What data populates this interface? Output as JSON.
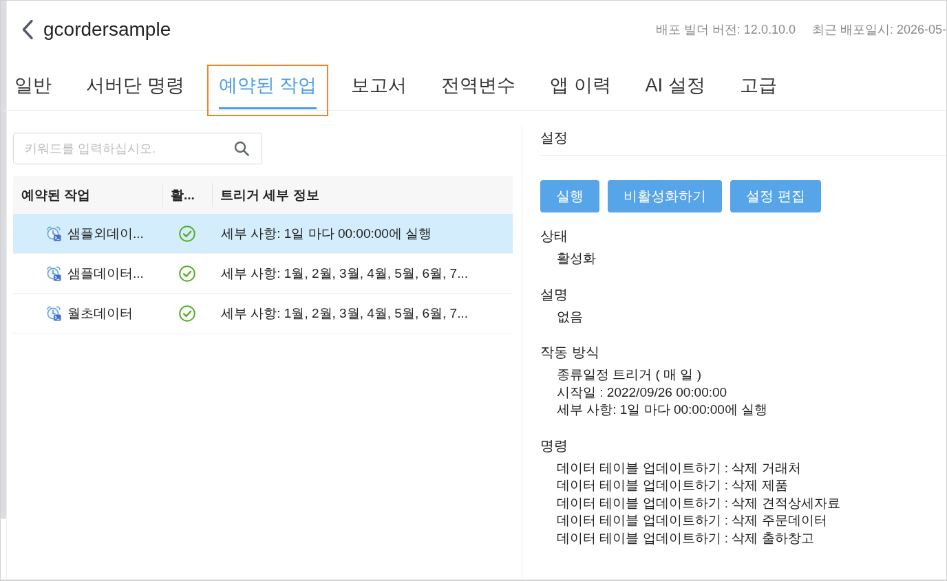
{
  "header": {
    "title": "gcordersample",
    "build_version": "배포 빌더 버전: 12.0.10.0",
    "last_deploy": "최근 배포일시: 2026-05-"
  },
  "tabs": [
    {
      "label": "일반",
      "selected": false,
      "highlighted": false
    },
    {
      "label": "서버단 명령",
      "selected": false,
      "highlighted": false
    },
    {
      "label": "예약된 작업",
      "selected": true,
      "highlighted": true
    },
    {
      "label": "보고서",
      "selected": false,
      "highlighted": false
    },
    {
      "label": "전역변수",
      "selected": false,
      "highlighted": false
    },
    {
      "label": "앱 이력",
      "selected": false,
      "highlighted": false
    },
    {
      "label": "AI 설정",
      "selected": false,
      "highlighted": false
    },
    {
      "label": "고급",
      "selected": false,
      "highlighted": false
    }
  ],
  "search": {
    "placeholder": "키워드를 입력하십시오."
  },
  "table": {
    "columns": [
      "예약된 작업",
      "활...",
      "트리거 세부 정보"
    ],
    "rows": [
      {
        "name": "샘플외데이...",
        "active": true,
        "detail": "세부 사항: 1일 마다 00:00:00에 실행",
        "selected": true
      },
      {
        "name": "샘플데이터...",
        "active": true,
        "detail": "세부 사항: 1월, 2월, 3월, 4월, 5월, 6월, 7...",
        "selected": false
      },
      {
        "name": "월초데이터",
        "active": true,
        "detail": "세부 사항: 1월, 2월, 3월, 4월, 5월, 6월, 7...",
        "selected": false
      }
    ]
  },
  "details": {
    "title": "설정",
    "buttons": [
      "실행",
      "비활성화하기",
      "설정 편집"
    ],
    "sections": [
      {
        "label": "상태",
        "lines": [
          "활성화"
        ]
      },
      {
        "label": "설명",
        "lines": [
          "없음"
        ]
      },
      {
        "label": "작동 방식",
        "lines": [
          "종류일정 트리거 ( 매 일 )",
          "시작일 : 2022/09/26 00:00:00",
          "세부 사항: 1일 마다 00:00:00에 실행"
        ]
      },
      {
        "label": "명령",
        "lines": [
          "데이터 테이블 업데이트하기 : 삭제 거래처",
          "데이터 테이블 업데이트하기 : 삭제 제품",
          "데이터 테이블 업데이트하기 : 삭제 견적상세자료",
          "데이터 테이블 업데이트하기 : 삭제 주문데이터",
          "데이터 테이블 업데이트하기 : 삭제 출하창고"
        ]
      }
    ]
  }
}
